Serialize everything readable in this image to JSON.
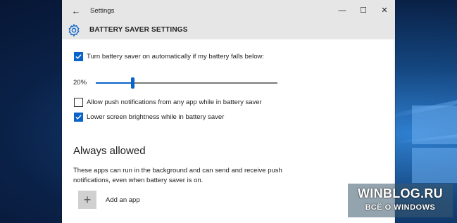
{
  "window": {
    "title": "Settings",
    "controls": {
      "minimize": "—",
      "maximize": "☐",
      "close": "✕"
    }
  },
  "header": {
    "title": "BATTERY SAVER SETTINGS",
    "icon": "gear-icon"
  },
  "battery": {
    "auto_on": {
      "label": "Turn battery saver on automatically if my battery falls below:",
      "checked": true
    },
    "threshold": {
      "value_label": "20%",
      "value": 0.2
    },
    "push_notifications": {
      "label": "Allow push notifications from any app while in battery saver",
      "checked": false
    },
    "lower_brightness": {
      "label": "Lower screen brightness while in battery saver",
      "checked": true
    }
  },
  "always_allowed": {
    "heading": "Always allowed",
    "description": "These apps can run in the background and can send and receive push notifications, even when battery saver is on.",
    "add_app_label": "Add an app",
    "add_icon": "+"
  },
  "watermark": {
    "line1": "WINBLOG.RU",
    "line2": "ВСЁ О WINDOWS"
  },
  "colors": {
    "accent": "#0a63c9",
    "titlebar": "#e6e6e6"
  }
}
